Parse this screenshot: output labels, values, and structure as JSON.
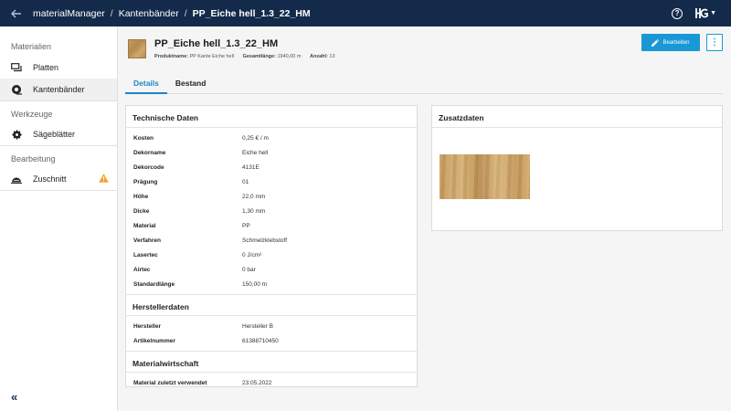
{
  "breadcrumb": [
    "materialManager",
    "Kantenbänder",
    "PP_Eiche hell_1.3_22_HM"
  ],
  "breadcrumb_sep": "/",
  "icons": {
    "back": "arrow-left-icon",
    "help": "help-circle-icon",
    "logo": "hg-logo-icon",
    "menu": "caret-down-icon"
  },
  "colors": {
    "topbar": "#142a4a",
    "accent": "#1a98d6",
    "warning": "#f0a028"
  },
  "sidebar": {
    "sections": [
      {
        "title": "Materialien",
        "items": [
          {
            "label": "Platten",
            "icon": "panels-icon"
          },
          {
            "label": "Kantenbänder",
            "icon": "edge-band-roll-icon",
            "active": true
          }
        ]
      },
      {
        "title": "Werkzeuge",
        "items": [
          {
            "label": "Sägeblätter",
            "icon": "saw-blade-icon"
          }
        ]
      },
      {
        "title": "Bearbeitung",
        "items": [
          {
            "label": "Zuschnitt",
            "icon": "cutting-icon",
            "warning": true
          }
        ]
      }
    ],
    "collapse_label": "«"
  },
  "header": {
    "title": "PP_Eiche hell_1.3_22_HM",
    "meta": [
      {
        "label": "Produktname:",
        "value": "PP Kante Eiche hell"
      },
      {
        "label": "Gesamtlänge:",
        "value": "1940,00 m"
      },
      {
        "label": "Anzahl:",
        "value": "13"
      }
    ],
    "edit_label": "Bearbeiten",
    "more_label": "⋮"
  },
  "tabs": [
    {
      "label": "Details",
      "active": true
    },
    {
      "label": "Bestand"
    }
  ],
  "technische_daten": {
    "title": "Technische Daten",
    "rows": [
      {
        "k": "Kosten",
        "v": "0,25 € / m"
      },
      {
        "k": "Dekorname",
        "v": "Eiche hell"
      },
      {
        "k": "Dekorcode",
        "v": "4131E"
      },
      {
        "k": "Prägung",
        "v": "01"
      },
      {
        "k": "Höhe",
        "v": "22,0 mm"
      },
      {
        "k": "Dicke",
        "v": "1,30 mm"
      },
      {
        "k": "Material",
        "v": "PP"
      },
      {
        "k": "Verfahren",
        "v": "Schmelzklebstoff"
      },
      {
        "k": "Lasertec",
        "v": "0 J/cm²"
      },
      {
        "k": "Airtec",
        "v": "0 bar"
      },
      {
        "k": "Standardlänge",
        "v": "150,00 m"
      }
    ]
  },
  "herstellerdaten": {
    "title": "Herstellerdaten",
    "rows": [
      {
        "k": "Hersteller",
        "v": "Hersteller B"
      },
      {
        "k": "Artikelnummer",
        "v": "61388710450"
      }
    ]
  },
  "materialwirtschaft": {
    "title": "Materialwirtschaft",
    "rows": [
      {
        "k": "Material zuletzt verwendet",
        "v": "23.05.2022"
      }
    ]
  },
  "zusatzdaten": {
    "title": "Zusatzdaten"
  }
}
